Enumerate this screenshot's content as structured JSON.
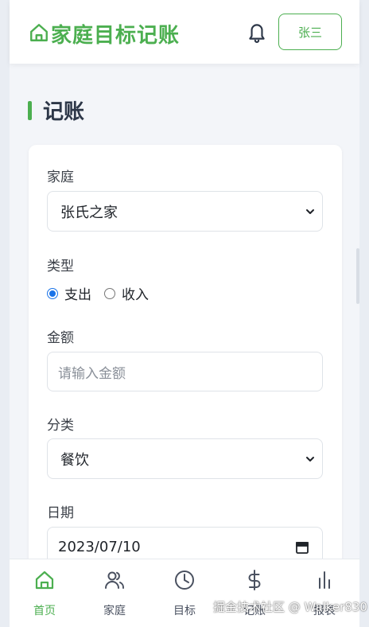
{
  "header": {
    "app_title": "家庭目标记账",
    "user_button_label": "张三"
  },
  "page": {
    "title": "记账"
  },
  "form": {
    "family_label": "家庭",
    "family_value": "张氏之家",
    "type_label": "类型",
    "type_options": [
      {
        "label": "支出",
        "selected": true
      },
      {
        "label": "收入",
        "selected": false
      }
    ],
    "amount_label": "金额",
    "amount_placeholder": "请输入金额",
    "category_label": "分类",
    "category_value": "餐饮",
    "date_label": "日期",
    "date_value": "2023/07/10"
  },
  "tabbar": {
    "items": [
      {
        "label": "首页",
        "icon": "home-icon",
        "active": true
      },
      {
        "label": "家庭",
        "icon": "users-icon",
        "active": false
      },
      {
        "label": "目标",
        "icon": "clock-icon",
        "active": false
      },
      {
        "label": "记账",
        "icon": "dollar-icon",
        "active": false
      },
      {
        "label": "报表",
        "icon": "bar-chart-icon",
        "active": false
      }
    ]
  },
  "watermark": "掘金技术社区 @ Walker830",
  "colors": {
    "brand": "#4caf50",
    "radio_selected": "#1a73e8"
  }
}
